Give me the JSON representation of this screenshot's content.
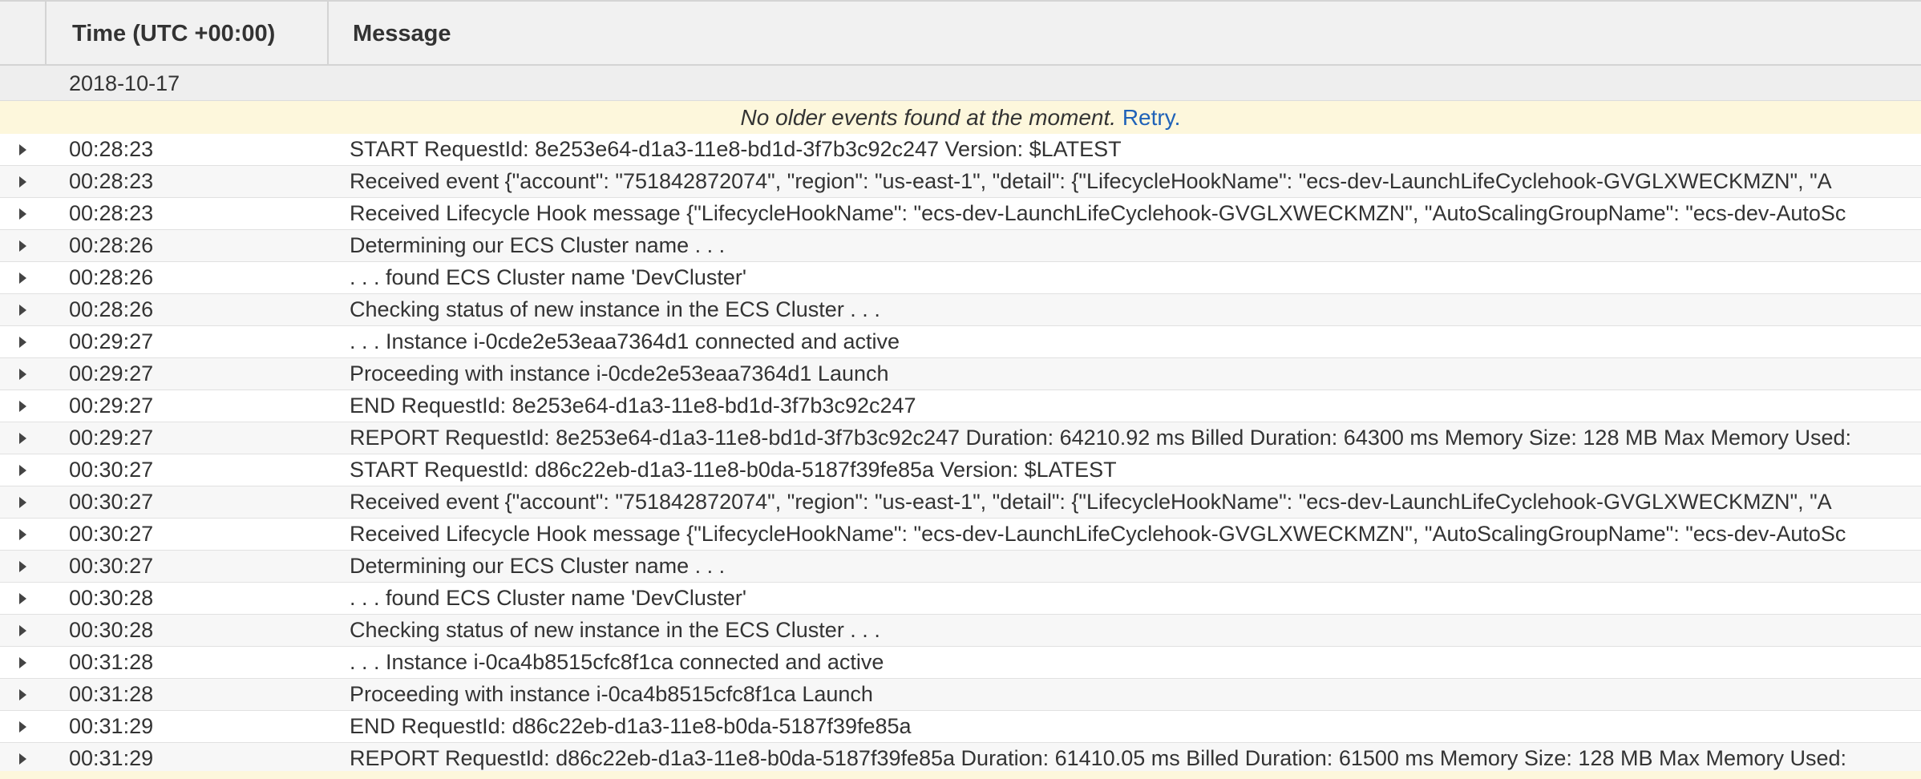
{
  "columns": {
    "time": "Time (UTC +00:00)",
    "message": "Message"
  },
  "date": "2018-10-17",
  "notice": {
    "text": "No older events found at the moment.",
    "retry": "Retry."
  },
  "events": [
    {
      "time": "00:28:23",
      "message": "START RequestId: 8e253e64-d1a3-11e8-bd1d-3f7b3c92c247 Version: $LATEST"
    },
    {
      "time": "00:28:23",
      "message": "Received event {\"account\": \"751842872074\", \"region\": \"us-east-1\", \"detail\": {\"LifecycleHookName\": \"ecs-dev-LaunchLifeCyclehook-GVGLXWECKMZN\", \"A"
    },
    {
      "time": "00:28:23",
      "message": "Received Lifecycle Hook message {\"LifecycleHookName\": \"ecs-dev-LaunchLifeCyclehook-GVGLXWECKMZN\", \"AutoScalingGroupName\": \"ecs-dev-AutoSc"
    },
    {
      "time": "00:28:26",
      "message": "Determining our ECS Cluster name . . ."
    },
    {
      "time": "00:28:26",
      "message": ". . . found ECS Cluster name 'DevCluster'"
    },
    {
      "time": "00:28:26",
      "message": "Checking status of new instance in the ECS Cluster . . ."
    },
    {
      "time": "00:29:27",
      "message": ". . . Instance i-0cde2e53eaa7364d1 connected and active"
    },
    {
      "time": "00:29:27",
      "message": "Proceeding with instance i-0cde2e53eaa7364d1 Launch"
    },
    {
      "time": "00:29:27",
      "message": "END RequestId: 8e253e64-d1a3-11e8-bd1d-3f7b3c92c247"
    },
    {
      "time": "00:29:27",
      "message": "REPORT RequestId: 8e253e64-d1a3-11e8-bd1d-3f7b3c92c247 Duration: 64210.92 ms Billed Duration: 64300 ms Memory Size: 128 MB Max Memory Used:"
    },
    {
      "time": "00:30:27",
      "message": "START RequestId: d86c22eb-d1a3-11e8-b0da-5187f39fe85a Version: $LATEST"
    },
    {
      "time": "00:30:27",
      "message": "Received event {\"account\": \"751842872074\", \"region\": \"us-east-1\", \"detail\": {\"LifecycleHookName\": \"ecs-dev-LaunchLifeCyclehook-GVGLXWECKMZN\", \"A"
    },
    {
      "time": "00:30:27",
      "message": "Received Lifecycle Hook message {\"LifecycleHookName\": \"ecs-dev-LaunchLifeCyclehook-GVGLXWECKMZN\", \"AutoScalingGroupName\": \"ecs-dev-AutoSc"
    },
    {
      "time": "00:30:27",
      "message": "Determining our ECS Cluster name . . ."
    },
    {
      "time": "00:30:28",
      "message": ". . . found ECS Cluster name 'DevCluster'"
    },
    {
      "time": "00:30:28",
      "message": "Checking status of new instance in the ECS Cluster . . ."
    },
    {
      "time": "00:31:28",
      "message": ". . . Instance i-0ca4b8515cfc8f1ca connected and active"
    },
    {
      "time": "00:31:28",
      "message": "Proceeding with instance i-0ca4b8515cfc8f1ca Launch"
    },
    {
      "time": "00:31:29",
      "message": "END RequestId: d86c22eb-d1a3-11e8-b0da-5187f39fe85a"
    },
    {
      "time": "00:31:29",
      "message": "REPORT RequestId: d86c22eb-d1a3-11e8-b0da-5187f39fe85a Duration: 61410.05 ms Billed Duration: 61500 ms Memory Size: 128 MB Max Memory Used:"
    }
  ]
}
